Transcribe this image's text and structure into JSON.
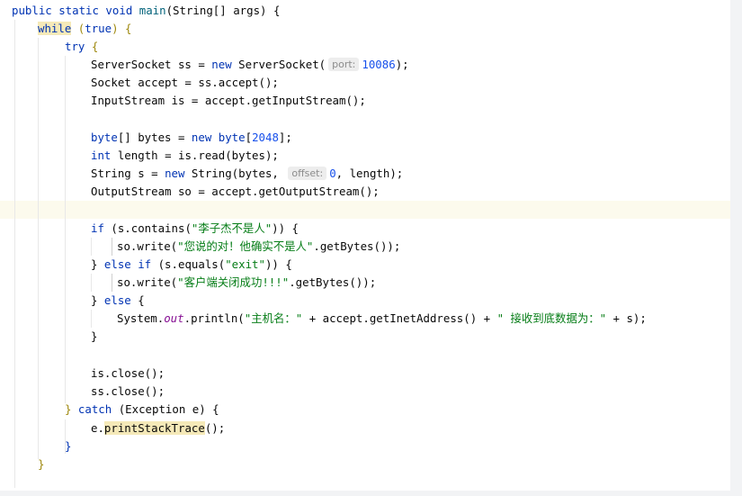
{
  "code": {
    "l1": {
      "p1": "public static void ",
      "p2": "main",
      "p3": "(String[] args) {"
    },
    "l2": {
      "kw": "while",
      "p2": " (",
      "p3": "true",
      "p4": ") {"
    },
    "l3": {
      "kw": "try",
      "p2": " {"
    },
    "l4": {
      "p1": "ServerSocket ss = ",
      "kw": "new",
      "p2": " ServerSocket(",
      "hint": "port:",
      "num": "10086",
      "p3": ");"
    },
    "l5": {
      "p1": "Socket accept = ss.accept();"
    },
    "l6": {
      "p1": "InputStream is = accept.getInputStream();"
    },
    "l7": {
      "kw": "byte",
      "p1": "[] bytes = ",
      "kw2": "new",
      "kw3": " byte",
      "p2": "[",
      "num": "2048",
      "p3": "];"
    },
    "l8": {
      "kw": "int",
      "p1": " length = is.read(bytes);"
    },
    "l9": {
      "p1": "String s = ",
      "kw": "new",
      "p2": " String(bytes, ",
      "hint": "offset:",
      "num": "0",
      "p3": ", length);"
    },
    "l10": {
      "p1": "OutputStream so = accept.getOutputStream();"
    },
    "l11": {
      "kw": "if",
      "p1": " (s.contains(",
      "str": "\"李子杰不是人\"",
      "p2": ")) {"
    },
    "l12": {
      "p1": "so.write(",
      "str": "\"您说的对！他确实不是人\"",
      "p2": ".getBytes());"
    },
    "l13": {
      "p0": "} ",
      "kw": "else if",
      "p1": " (s.equals(",
      "str": "\"exit\"",
      "p2": ")) {"
    },
    "l14": {
      "p1": "so.write(",
      "str": "\"客户端关闭成功!!!\"",
      "p2": ".getBytes());"
    },
    "l15": {
      "p0": "} ",
      "kw": "else",
      "p1": " {"
    },
    "l16": {
      "p1": "System.",
      "field": "out",
      "p2": ".println(",
      "str1": "\"主机名：\"",
      "p3": " + accept.getInetAddress() + ",
      "str2": "\" 接收到底数据为：\"",
      "p4": " + s);"
    },
    "l17": {
      "p1": "}"
    },
    "l18": {
      "p1": "is.close();"
    },
    "l19": {
      "p1": "ss.close();"
    },
    "l20": {
      "p0": "} ",
      "kw": "catch",
      "p1": " (Exception e) {"
    },
    "l21": {
      "p1": "e.",
      "method": "printStackTrace",
      "p2": "();"
    },
    "l22": {
      "p1": "}"
    },
    "l23": {
      "p1": "}"
    }
  }
}
